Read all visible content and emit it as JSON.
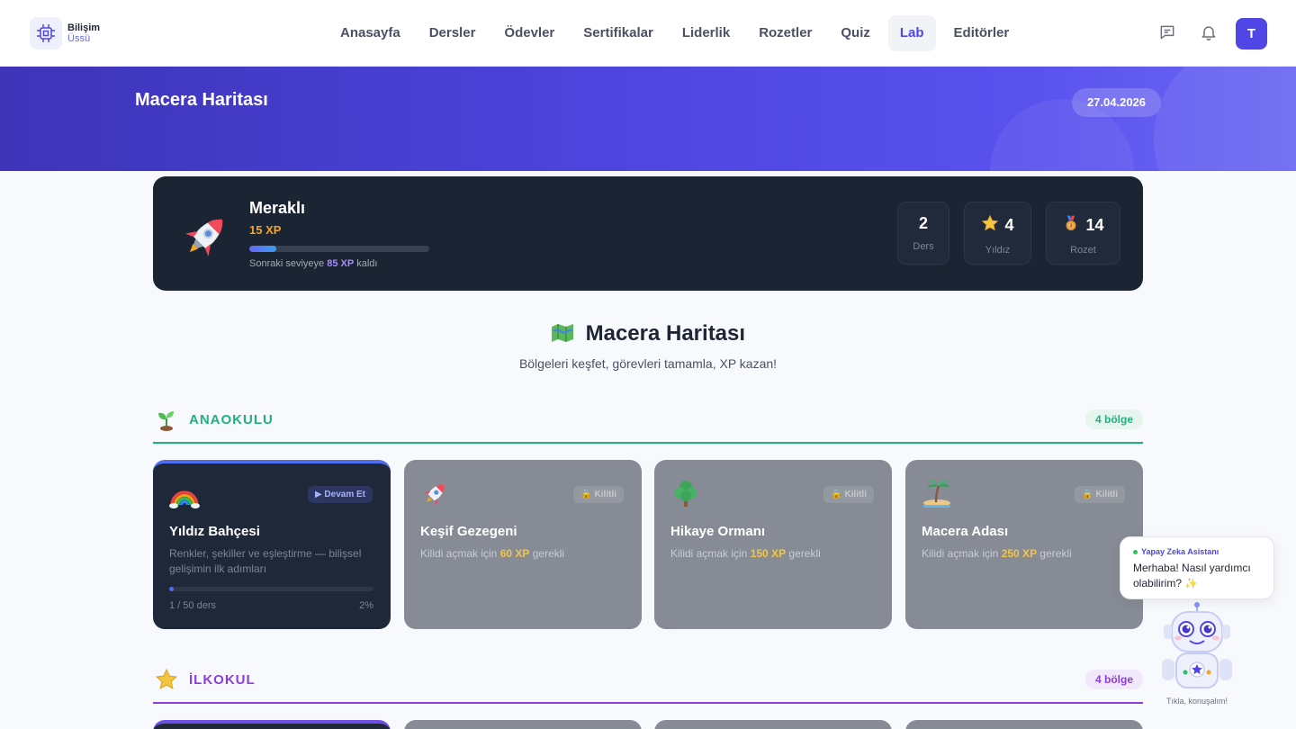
{
  "app": {
    "logo_line1": "Bilişim",
    "logo_line2": "Üssü",
    "avatar_letter": "T"
  },
  "nav": {
    "items": [
      "Anasayfa",
      "Dersler",
      "Ödevler",
      "Sertifikalar",
      "Liderlik",
      "Rozetler",
      "Quiz",
      "Lab",
      "Editörler"
    ],
    "active": "Lab"
  },
  "hero": {
    "title": "Macera Haritası",
    "date": "27.04.2026"
  },
  "profile": {
    "level_name": "Meraklı",
    "xp": "15 XP",
    "progress_fraction": 0.15,
    "next_prefix": "Sonraki seviyeye",
    "next_xp": "85 XP",
    "next_suffix": "kaldı",
    "stats": [
      {
        "value": "2",
        "label": "Ders",
        "icon": ""
      },
      {
        "value": "4",
        "label": "Yıldız",
        "icon": "star-icon"
      },
      {
        "value": "14",
        "label": "Rozet",
        "icon": "medal-icon"
      }
    ]
  },
  "map": {
    "title": "Macera Haritası",
    "subtitle": "Bölgeleri keşfet, görevleri tamamla, XP kazan!"
  },
  "levels": [
    {
      "name": "ANAOKULU",
      "count": "4 bölge",
      "color": "#22b07d",
      "icon": "seedling-icon",
      "regions": [
        {
          "title": "Yıldız Bahçesi",
          "desc": "Renkler, şekiller ve eşleştirme — bilişsel gelişimin ilk adımları",
          "badge": "▶ Devam Et",
          "status": "active",
          "progress_text": "1 / 50 ders",
          "progress_pct": "2%",
          "progress_fraction": 0.02,
          "icon": "rainbow-icon"
        },
        {
          "title": "Keşif Gezegeni",
          "desc_prefix": "Kilidi açmak için",
          "desc_xp": "60 XP",
          "desc_suffix": "gerekli",
          "badge": "🔒 Kilitli",
          "status": "locked",
          "icon": "rocket-icon"
        },
        {
          "title": "Hikaye Ormanı",
          "desc_prefix": "Kilidi açmak için",
          "desc_xp": "150 XP",
          "desc_suffix": "gerekli",
          "badge": "🔒 Kilitli",
          "status": "locked",
          "icon": "tree-icon"
        },
        {
          "title": "Macera Adası",
          "desc_prefix": "Kilidi açmak için",
          "desc_xp": "250 XP",
          "desc_suffix": "gerekli",
          "badge": "🔒 Kilitli",
          "status": "locked",
          "icon": "island-icon"
        }
      ]
    },
    {
      "name": "İLKOKUL",
      "count": "4 bölge",
      "color": "#8b3fd9",
      "icon": "star-icon"
    }
  ],
  "assistant": {
    "header": "Yapay Zeka Asistanı",
    "message": "Merhaba! Nasıl yardımcı olabilirim? ✨",
    "caption": "Tıkla, konuşalım!"
  }
}
